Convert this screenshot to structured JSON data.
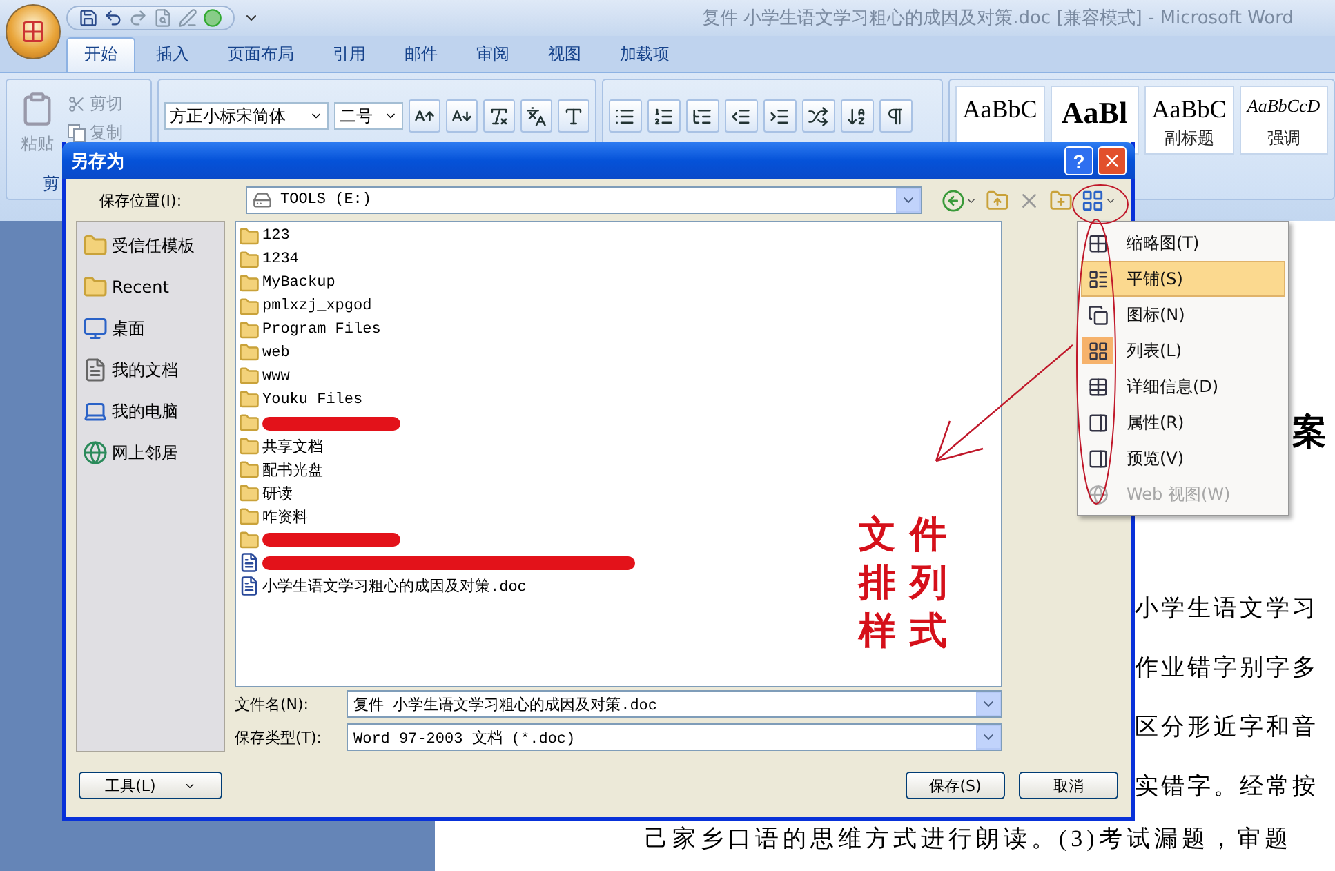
{
  "word": {
    "title": "复件 小学生语文学习粗心的成因及对策.doc [兼容模式] - Microsoft Word",
    "tabs": [
      {
        "label": "开始",
        "selected": true
      },
      {
        "label": "插入",
        "selected": false
      },
      {
        "label": "页面布局",
        "selected": false
      },
      {
        "label": "引用",
        "selected": false
      },
      {
        "label": "邮件",
        "selected": false
      },
      {
        "label": "审阅",
        "selected": false
      },
      {
        "label": "视图",
        "selected": false
      },
      {
        "label": "加载项",
        "selected": false
      }
    ],
    "clipboard": {
      "paste": "粘贴",
      "cut": "剪切",
      "copy": "复制",
      "group": "剪"
    },
    "font": {
      "name": "方正小标宋简体",
      "size": "二号"
    },
    "styles": [
      {
        "preview": "AaBbC",
        "kind": "normal"
      },
      {
        "preview": "AaBl",
        "kind": "heading"
      },
      {
        "preview": "AaBbC",
        "label": "副标题",
        "kind": "normal"
      },
      {
        "preview": "AaBbCcD",
        "label": "强调",
        "kind": "italic"
      }
    ],
    "document": {
      "heading": "案",
      "lines": [
        "小学生语文学习",
        "作业错字别字多",
        "区分形近字和音",
        "实错字。经常按"
      ],
      "last_line": "己家乡口语的思维方式进行朗读。(3)考试漏题，审题"
    }
  },
  "dialog": {
    "title": "另存为",
    "help": "?",
    "location_label": "保存位置(I):",
    "location": "TOOLS (E:)",
    "places": [
      {
        "label": "受信任模板",
        "kind": "folder"
      },
      {
        "label": "Recent",
        "kind": "folder"
      },
      {
        "label": "桌面",
        "kind": "desktop"
      },
      {
        "label": "我的文档",
        "kind": "documents"
      },
      {
        "label": "我的电脑",
        "kind": "computer"
      },
      {
        "label": "网上邻居",
        "kind": "network"
      }
    ],
    "files": [
      {
        "label": "123",
        "kind": "folder"
      },
      {
        "label": "1234",
        "kind": "folder"
      },
      {
        "label": "MyBackup",
        "kind": "folder"
      },
      {
        "label": "pmlxzj_xpgod",
        "kind": "folder"
      },
      {
        "label": "Program Files",
        "kind": "folder"
      },
      {
        "label": "web",
        "kind": "folder"
      },
      {
        "label": "www",
        "kind": "folder"
      },
      {
        "label": "Youku Files",
        "kind": "folder"
      },
      {
        "kind": "redacted-folder"
      },
      {
        "label": "共享文档",
        "kind": "folder"
      },
      {
        "label": "配书光盘",
        "kind": "folder"
      },
      {
        "label": "研读",
        "kind": "folder"
      },
      {
        "label": "咋资料",
        "kind": "folder"
      },
      {
        "kind": "redacted-folder"
      },
      {
        "kind": "redacted-doc"
      },
      {
        "label": "小学生语文学习粗心的成因及对策.doc",
        "kind": "doc"
      }
    ],
    "filename_label": "文件名(N):",
    "filename": "复件 小学生语文学习粗心的成因及对策.doc",
    "filetype_label": "保存类型(T):",
    "filetype": "Word 97-2003 文档 (*.doc)",
    "tools": "工具(L)",
    "save": "保存(S)",
    "cancel": "取消"
  },
  "view_menu": [
    {
      "label": "缩略图(T)",
      "kind": "thumbnails",
      "selected": false,
      "checked": false,
      "disabled": false
    },
    {
      "label": "平铺(S)",
      "kind": "tiles",
      "selected": true,
      "checked": false,
      "disabled": false
    },
    {
      "label": "图标(N)",
      "kind": "icons",
      "selected": false,
      "checked": false,
      "disabled": false
    },
    {
      "label": "列表(L)",
      "kind": "list",
      "selected": false,
      "checked": true,
      "disabled": false
    },
    {
      "label": "详细信息(D)",
      "kind": "details",
      "selected": false,
      "checked": false,
      "disabled": false
    },
    {
      "label": "属性(R)",
      "kind": "properties",
      "selected": false,
      "checked": false,
      "disabled": false
    },
    {
      "label": "预览(V)",
      "kind": "preview",
      "selected": false,
      "checked": false,
      "disabled": false
    },
    {
      "label": "Web 视图(W)",
      "kind": "web",
      "selected": false,
      "checked": false,
      "disabled": true
    }
  ],
  "annotation": {
    "text": "文件排列样式"
  }
}
